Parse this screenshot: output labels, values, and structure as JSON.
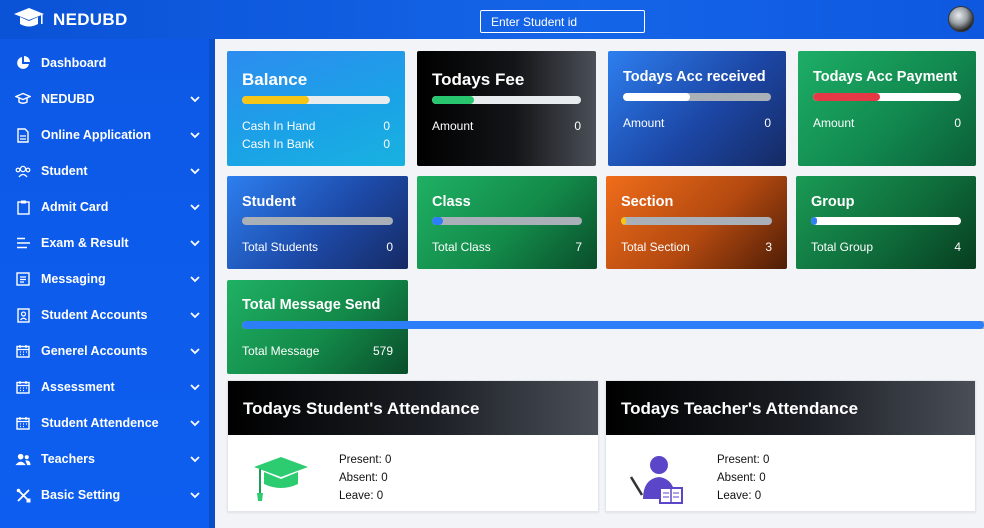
{
  "app": {
    "brand": "NEDUBD",
    "search_placeholder": "Enter Student id"
  },
  "sidebar": {
    "items": [
      {
        "label": "Dashboard",
        "icon": "pie-chart-icon",
        "chevron": false
      },
      {
        "label": "NEDUBD",
        "icon": "graduation-cap-icon",
        "chevron": true
      },
      {
        "label": "Online Application",
        "icon": "document-icon",
        "chevron": true
      },
      {
        "label": "Student",
        "icon": "users-icon",
        "chevron": true
      },
      {
        "label": "Admit Card",
        "icon": "clipboard-icon",
        "chevron": true
      },
      {
        "label": "Exam & Result",
        "icon": "list-icon",
        "chevron": true
      },
      {
        "label": "Messaging",
        "icon": "message-icon",
        "chevron": true
      },
      {
        "label": "Student Accounts",
        "icon": "id-card-icon",
        "chevron": true
      },
      {
        "label": "Generel Accounts",
        "icon": "calendar-icon",
        "chevron": true
      },
      {
        "label": "Assessment",
        "icon": "calendar-icon",
        "chevron": true
      },
      {
        "label": "Student Attendence",
        "icon": "calendar-icon",
        "chevron": true
      },
      {
        "label": "Teachers",
        "icon": "users-icon",
        "chevron": true
      },
      {
        "label": "Basic Setting",
        "icon": "tools-icon",
        "chevron": true
      }
    ]
  },
  "cards": {
    "balance": {
      "title": "Balance",
      "progress": 0.45,
      "rows": [
        {
          "label": "Cash In Hand",
          "value": "0"
        },
        {
          "label": "Cash In Bank",
          "value": "0"
        }
      ]
    },
    "todays_fee": {
      "title": "Todays Fee",
      "progress": 0.28,
      "rows": [
        {
          "label": "Amount",
          "value": "0"
        }
      ]
    },
    "acc_received": {
      "title": "Todays Acc received",
      "progress": 0.45,
      "rows": [
        {
          "label": "Amount",
          "value": "0"
        }
      ]
    },
    "acc_payment": {
      "title": "Todays Acc Payment",
      "progress": 0.45,
      "rows": [
        {
          "label": "Amount",
          "value": "0"
        }
      ]
    },
    "student": {
      "title": "Student",
      "progress": 0,
      "rows": [
        {
          "label": "Total Students",
          "value": "0"
        }
      ]
    },
    "class": {
      "title": "Class",
      "progress": 0.07,
      "rows": [
        {
          "label": "Total Class",
          "value": "7"
        }
      ]
    },
    "section": {
      "title": "Section",
      "progress": 0.03,
      "rows": [
        {
          "label": "Total Section",
          "value": "3"
        }
      ]
    },
    "group": {
      "title": "Group",
      "progress": 0.04,
      "rows": [
        {
          "label": "Total Group",
          "value": "4"
        }
      ]
    },
    "message": {
      "title": "Total Message Send",
      "progress": 1,
      "rows": [
        {
          "label": "Total Message",
          "value": "579"
        }
      ]
    }
  },
  "attendance": {
    "students": {
      "title": "Todays Student's Attendance",
      "present": "Present: 0",
      "absent": "Absent: 0",
      "leave": "Leave: 0"
    },
    "teachers": {
      "title": "Todays Teacher's Attendance",
      "present": "Present: 0",
      "absent": "Absent: 0",
      "leave": "Leave: 0"
    }
  },
  "colors": {
    "sidebar": "#0d5ef0",
    "bar_yellow": "#f5c518",
    "bar_green": "#28c76f",
    "bar_red": "#e53945",
    "bar_blue": "#2d7ff9",
    "cap_green": "#2ecc71",
    "teacher_purple": "#5b45c9"
  }
}
